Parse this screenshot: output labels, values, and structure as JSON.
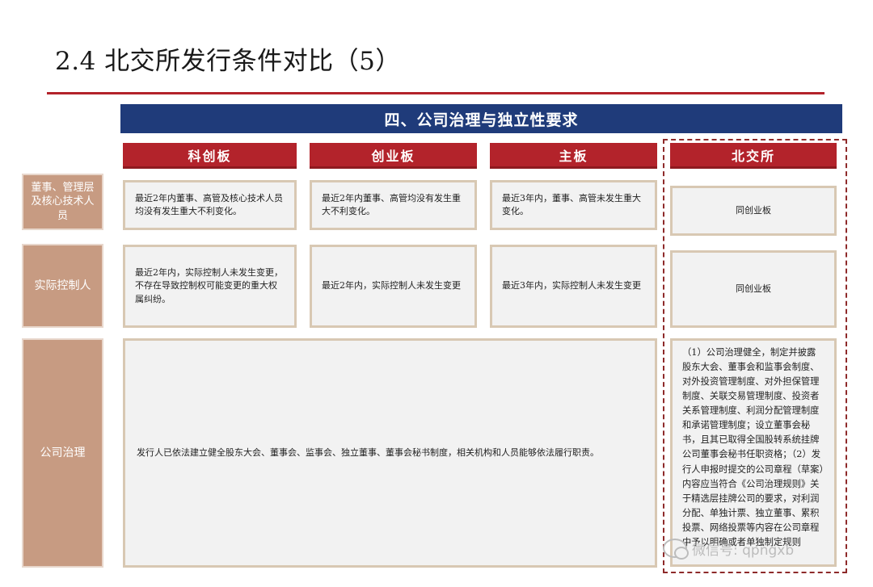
{
  "title": "2.4 北交所发行条件对比（5）",
  "banner": "四、公司治理与独立性要求",
  "columns": [
    "科创板",
    "创业板",
    "主板",
    "北交所"
  ],
  "rows": [
    {
      "label": "董事、管理层及核心技术人员",
      "cells": [
        "最近2年内董事、高管及核心技术人员均没有发生重大不利变化。",
        "最近2年内董事、高管均没有发生重大不利变化。",
        "最近3年内，董事、高管未发生重大变化。",
        "同创业板"
      ]
    },
    {
      "label": "实际控制人",
      "cells": [
        "最近2年内，实际控制人未发生变更，不存在导致控制权可能变更的重大权属纠纷。",
        "最近2年内，实际控制人未发生变更",
        "最近3年内，实际控制人未发生变更",
        "同创业板"
      ]
    },
    {
      "label": "公司治理",
      "merged": "发行人已依法建立健全股东大会、董事会、监事会、独立董事、董事会秘书制度，相关机构和人员能够依法履行职责。",
      "bjs": "（1）公司治理健全，制定并披露股东大会、董事会和监事会制度、对外投资管理制度、对外担保管理制度、关联交易管理制度、投资者关系管理制度、利润分配管理制度和承诺管理制度；设立董事会秘书，且其已取得全国股转系统挂牌公司董事会秘书任职资格；（2）发行人申报时提交的公司章程（草案）内容应当符合《公司治理规则》关于精选层挂牌公司的要求，对利润分配、单独计票、独立董事、累积投票、网络投票等内容在公司章程中予以明确或者单独制定规则"
    }
  ],
  "watermark": "微信号: qpngxb",
  "colors": {
    "accent_red": "#b3232b",
    "banner_blue": "#1f3b7a",
    "row_tan": "#c79b82"
  }
}
